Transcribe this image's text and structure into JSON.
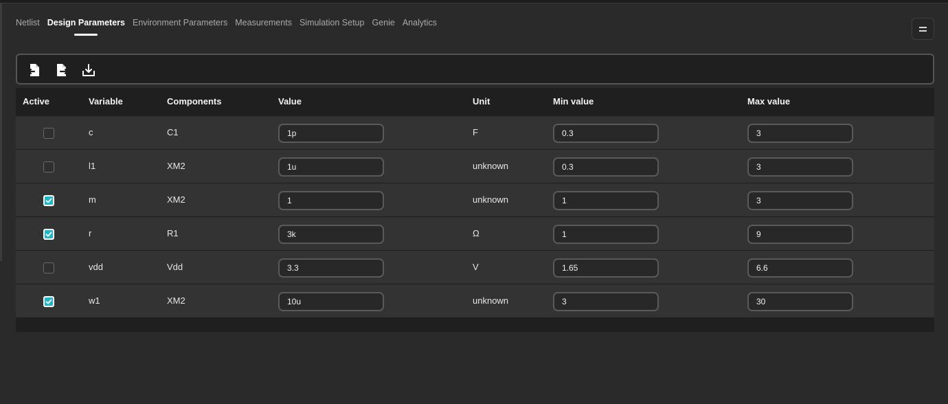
{
  "tabs": [
    {
      "label": "Netlist"
    },
    {
      "label": "Design Parameters"
    },
    {
      "label": "Environment Parameters"
    },
    {
      "label": "Measurements"
    },
    {
      "label": "Simulation Setup"
    },
    {
      "label": "Genie"
    },
    {
      "label": "Analytics"
    }
  ],
  "active_tab": "Design Parameters",
  "toolbar": {
    "icons": [
      "file-import-icon",
      "file-export-icon",
      "download-icon"
    ]
  },
  "table": {
    "headers": {
      "active": "Active",
      "variable": "Variable",
      "components": "Components",
      "value": "Value",
      "unit": "Unit",
      "min": "Min value",
      "max": "Max value"
    },
    "rows": [
      {
        "active": false,
        "variable": "c",
        "components": "C1",
        "value": "1p",
        "unit": "F",
        "min": "0.3",
        "max": "3"
      },
      {
        "active": false,
        "variable": "l1",
        "components": "XM2",
        "value": "1u",
        "unit": "unknown",
        "min": "0.3",
        "max": "3"
      },
      {
        "active": true,
        "variable": "m",
        "components": "XM2",
        "value": "1",
        "unit": "unknown",
        "min": "1",
        "max": "3"
      },
      {
        "active": true,
        "variable": "r",
        "components": "R1",
        "value": "3k",
        "unit": "Ω",
        "min": "1",
        "max": "9"
      },
      {
        "active": false,
        "variable": "vdd",
        "components": "Vdd",
        "value": "3.3",
        "unit": "V",
        "min": "1.65",
        "max": "6.6"
      },
      {
        "active": true,
        "variable": "w1",
        "components": "XM2",
        "value": "10u",
        "unit": "unknown",
        "min": "3",
        "max": "30"
      }
    ]
  },
  "colors": {
    "accent_checkbox": "#1fb6c9",
    "background": "#2a2a2a",
    "row": "#333333"
  }
}
